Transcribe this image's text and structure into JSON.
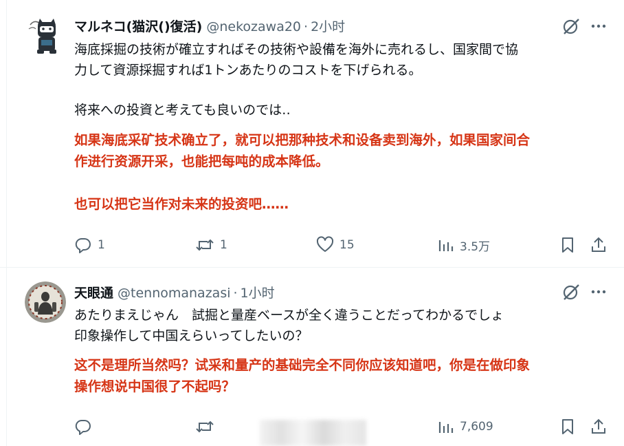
{
  "tweets": [
    {
      "name": "マルネコ(猫沢()復活)",
      "handle": "@nekozawa20",
      "separator": "·",
      "time": "2小时",
      "text_lines": [
        "海底採掘の技術が確立すればその技術や設備を海外に売れるし、国家間で協",
        "力して資源採掘すれば1トンあたりのコストを下げられる。",
        "将来への投資と考えても良いのでは‥"
      ],
      "translation_lines": [
        "如果海底采矿技术确立了，就可以把那种技术和设备卖到海外，如果国家间合",
        "作进行资源开采，也能把每吨的成本降低。",
        "也可以把它当作对未来的投资吧……"
      ],
      "actions": {
        "reply": "1",
        "retweet": "1",
        "like": "15",
        "views": "3.5万"
      }
    },
    {
      "name": "天眼通",
      "handle": "@tennomanazasi",
      "separator": "·",
      "time": "1小时",
      "text_lines": [
        "あたりまえじゃん　試掘と量産ベースが全く違うことだってわかるでしょ",
        "印象操作して中国えらいってしたいの？"
      ],
      "translation_lines": [
        "这不是理所当然吗？试采和量产的基础完全不同你应该知道吧，你是在做印象",
        "操作想说中国很了不起吗？"
      ],
      "actions": {
        "reply": "",
        "retweet": "",
        "like": "",
        "views": "7,609"
      }
    }
  ],
  "colors": {
    "translation": "#d63516",
    "secondary": "#536471",
    "primary": "#0f1419"
  },
  "icons": [
    "grok-icon",
    "more-icon",
    "reply-icon",
    "retweet-icon",
    "like-icon",
    "views-icon",
    "bookmark-icon",
    "share-icon"
  ]
}
